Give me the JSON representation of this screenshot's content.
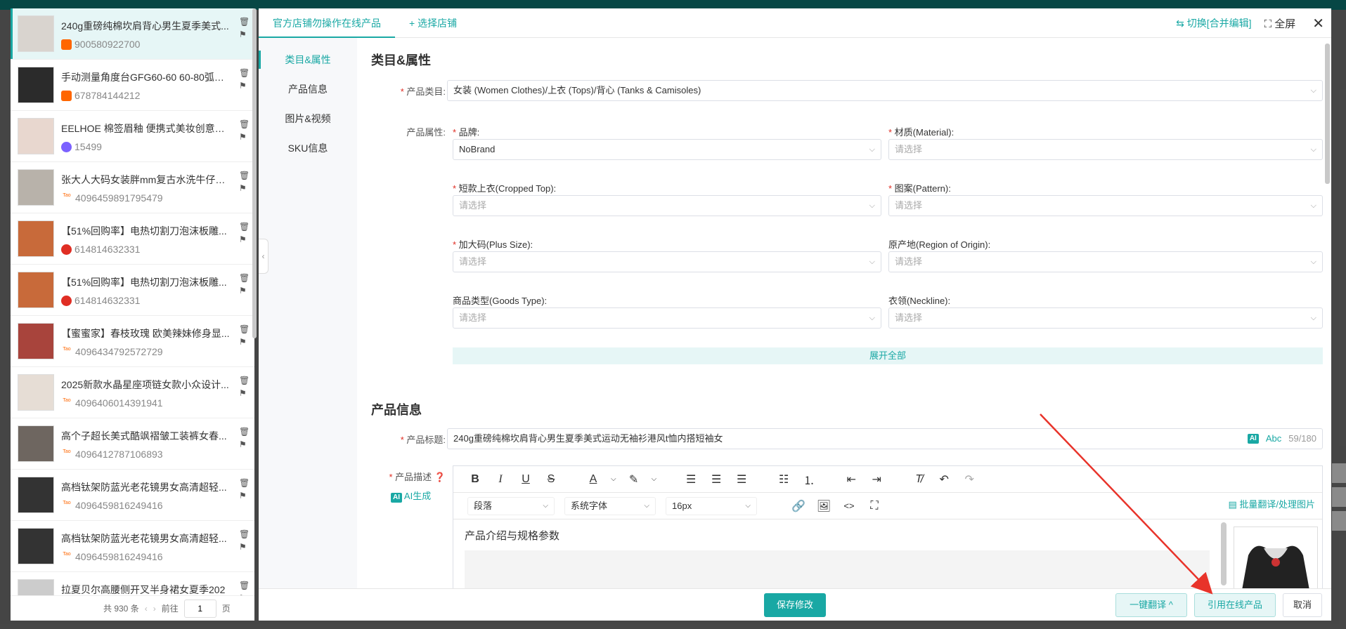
{
  "list": {
    "items": [
      {
        "title": "240g重磅纯棉坎肩背心男生夏季美式...",
        "id": "900580922700",
        "src": "tm",
        "active": true
      },
      {
        "title": "手动测量角度台GFG60-60 60-80弧形...",
        "id": "678784144212",
        "src": "tm"
      },
      {
        "title": "EELHOE 棉签眉釉 便携式美妆创意不...",
        "id": "15499",
        "src": "tm2"
      },
      {
        "title": "张大人大码女装胖mm复古水洗牛仔吊...",
        "id": "4096459891795479",
        "src": "tao"
      },
      {
        "title": "【51%回购率】电热切割刀泡沫板雕...",
        "id": "614814632331",
        "src": "pdd"
      },
      {
        "title": "【51%回购率】电热切割刀泡沫板雕...",
        "id": "614814632331",
        "src": "pdd"
      },
      {
        "title": "【蜜蜜家】春枝玫瑰 欧美辣妹修身显...",
        "id": "4096434792572729",
        "src": "tao"
      },
      {
        "title": "2025新款水晶星座项链女款小众设计...",
        "id": "4096406014391941",
        "src": "tao"
      },
      {
        "title": "高个子超长美式酷飒褶皱工装裤女春...",
        "id": "4096412787106893",
        "src": "tao"
      },
      {
        "title": "高档钛架防蓝光老花镜男女高清超轻...",
        "id": "4096459816249416",
        "src": "tao"
      },
      {
        "title": "高档钛架防蓝光老花镜男女高清超轻...",
        "id": "4096459816249416",
        "src": "tao"
      },
      {
        "title": "拉夏贝尔高腰侧开叉半身裙女夏季202",
        "id": "",
        "src": "tao"
      }
    ],
    "pager": {
      "total": "共 930 条",
      "prev_label": "前往",
      "page": "1",
      "page_suffix": "页"
    }
  },
  "tabs": {
    "active": "官方店铺勿操作在线产品",
    "add": "+ 选择店铺",
    "switch": "⇆ 切换[合并编辑]",
    "fullscreen": "⛶ 全屏",
    "close": "✕"
  },
  "nav": [
    "类目&属性",
    "产品信息",
    "图片&视频",
    "SKU信息"
  ],
  "attrs": {
    "section_title": "类目&属性",
    "category_label": "产品类目:",
    "category_value": "女装 (Women Clothes)/上衣 (Tops)/背心 (Tanks & Camisoles)",
    "props_label": "产品属性:",
    "brand_label": "品牌:",
    "brand_value": "NoBrand",
    "material_label": "材质(Material):",
    "cropped_label": "短款上衣(Cropped Top):",
    "pattern_label": "图案(Pattern):",
    "plussize_label": "加大码(Plus Size):",
    "origin_label": "原产地(Region of Origin):",
    "goodstype_label": "商品类型(Goods Type):",
    "neckline_label": "衣领(Neckline):",
    "placeholder": "请选择",
    "expand": "展开全部"
  },
  "product": {
    "section_title": "产品信息",
    "title_label": "产品标题:",
    "title_value": "240g重磅纯棉坎肩背心男生夏季美式运动无袖衫港风t恤内搭短袖女",
    "ai": "AI",
    "abc": "Abc",
    "count": "59/180",
    "desc_label": "产品描述",
    "ai_generate": "AI生成",
    "para": "段落",
    "font": "系统字体",
    "size": "16px",
    "batch": "批量翻译/处理图片",
    "body": "产品介绍与规格参数"
  },
  "footer": {
    "save": "保存修改",
    "translate": "一键翻译 ^",
    "quote": "引用在线产品",
    "cancel": "取消"
  },
  "colors": {
    "accent": "#19a8a4",
    "danger": "#e02e24",
    "arrow": "#e8332a"
  }
}
